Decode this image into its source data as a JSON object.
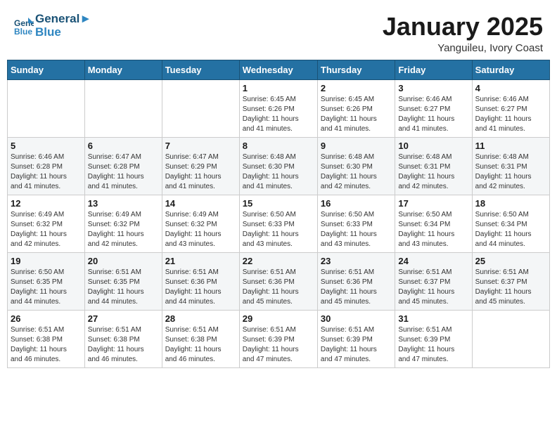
{
  "header": {
    "logo_line1": "General",
    "logo_line2": "Blue",
    "month": "January 2025",
    "location": "Yanguileu, Ivory Coast"
  },
  "weekdays": [
    "Sunday",
    "Monday",
    "Tuesday",
    "Wednesday",
    "Thursday",
    "Friday",
    "Saturday"
  ],
  "weeks": [
    [
      {
        "day": "",
        "info": ""
      },
      {
        "day": "",
        "info": ""
      },
      {
        "day": "",
        "info": ""
      },
      {
        "day": "1",
        "info": "Sunrise: 6:45 AM\nSunset: 6:26 PM\nDaylight: 11 hours\nand 41 minutes."
      },
      {
        "day": "2",
        "info": "Sunrise: 6:45 AM\nSunset: 6:26 PM\nDaylight: 11 hours\nand 41 minutes."
      },
      {
        "day": "3",
        "info": "Sunrise: 6:46 AM\nSunset: 6:27 PM\nDaylight: 11 hours\nand 41 minutes."
      },
      {
        "day": "4",
        "info": "Sunrise: 6:46 AM\nSunset: 6:27 PM\nDaylight: 11 hours\nand 41 minutes."
      }
    ],
    [
      {
        "day": "5",
        "info": "Sunrise: 6:46 AM\nSunset: 6:28 PM\nDaylight: 11 hours\nand 41 minutes."
      },
      {
        "day": "6",
        "info": "Sunrise: 6:47 AM\nSunset: 6:28 PM\nDaylight: 11 hours\nand 41 minutes."
      },
      {
        "day": "7",
        "info": "Sunrise: 6:47 AM\nSunset: 6:29 PM\nDaylight: 11 hours\nand 41 minutes."
      },
      {
        "day": "8",
        "info": "Sunrise: 6:48 AM\nSunset: 6:30 PM\nDaylight: 11 hours\nand 41 minutes."
      },
      {
        "day": "9",
        "info": "Sunrise: 6:48 AM\nSunset: 6:30 PM\nDaylight: 11 hours\nand 42 minutes."
      },
      {
        "day": "10",
        "info": "Sunrise: 6:48 AM\nSunset: 6:31 PM\nDaylight: 11 hours\nand 42 minutes."
      },
      {
        "day": "11",
        "info": "Sunrise: 6:48 AM\nSunset: 6:31 PM\nDaylight: 11 hours\nand 42 minutes."
      }
    ],
    [
      {
        "day": "12",
        "info": "Sunrise: 6:49 AM\nSunset: 6:32 PM\nDaylight: 11 hours\nand 42 minutes."
      },
      {
        "day": "13",
        "info": "Sunrise: 6:49 AM\nSunset: 6:32 PM\nDaylight: 11 hours\nand 42 minutes."
      },
      {
        "day": "14",
        "info": "Sunrise: 6:49 AM\nSunset: 6:32 PM\nDaylight: 11 hours\nand 43 minutes."
      },
      {
        "day": "15",
        "info": "Sunrise: 6:50 AM\nSunset: 6:33 PM\nDaylight: 11 hours\nand 43 minutes."
      },
      {
        "day": "16",
        "info": "Sunrise: 6:50 AM\nSunset: 6:33 PM\nDaylight: 11 hours\nand 43 minutes."
      },
      {
        "day": "17",
        "info": "Sunrise: 6:50 AM\nSunset: 6:34 PM\nDaylight: 11 hours\nand 43 minutes."
      },
      {
        "day": "18",
        "info": "Sunrise: 6:50 AM\nSunset: 6:34 PM\nDaylight: 11 hours\nand 44 minutes."
      }
    ],
    [
      {
        "day": "19",
        "info": "Sunrise: 6:50 AM\nSunset: 6:35 PM\nDaylight: 11 hours\nand 44 minutes."
      },
      {
        "day": "20",
        "info": "Sunrise: 6:51 AM\nSunset: 6:35 PM\nDaylight: 11 hours\nand 44 minutes."
      },
      {
        "day": "21",
        "info": "Sunrise: 6:51 AM\nSunset: 6:36 PM\nDaylight: 11 hours\nand 44 minutes."
      },
      {
        "day": "22",
        "info": "Sunrise: 6:51 AM\nSunset: 6:36 PM\nDaylight: 11 hours\nand 45 minutes."
      },
      {
        "day": "23",
        "info": "Sunrise: 6:51 AM\nSunset: 6:36 PM\nDaylight: 11 hours\nand 45 minutes."
      },
      {
        "day": "24",
        "info": "Sunrise: 6:51 AM\nSunset: 6:37 PM\nDaylight: 11 hours\nand 45 minutes."
      },
      {
        "day": "25",
        "info": "Sunrise: 6:51 AM\nSunset: 6:37 PM\nDaylight: 11 hours\nand 45 minutes."
      }
    ],
    [
      {
        "day": "26",
        "info": "Sunrise: 6:51 AM\nSunset: 6:38 PM\nDaylight: 11 hours\nand 46 minutes."
      },
      {
        "day": "27",
        "info": "Sunrise: 6:51 AM\nSunset: 6:38 PM\nDaylight: 11 hours\nand 46 minutes."
      },
      {
        "day": "28",
        "info": "Sunrise: 6:51 AM\nSunset: 6:38 PM\nDaylight: 11 hours\nand 46 minutes."
      },
      {
        "day": "29",
        "info": "Sunrise: 6:51 AM\nSunset: 6:39 PM\nDaylight: 11 hours\nand 47 minutes."
      },
      {
        "day": "30",
        "info": "Sunrise: 6:51 AM\nSunset: 6:39 PM\nDaylight: 11 hours\nand 47 minutes."
      },
      {
        "day": "31",
        "info": "Sunrise: 6:51 AM\nSunset: 6:39 PM\nDaylight: 11 hours\nand 47 minutes."
      },
      {
        "day": "",
        "info": ""
      }
    ]
  ]
}
